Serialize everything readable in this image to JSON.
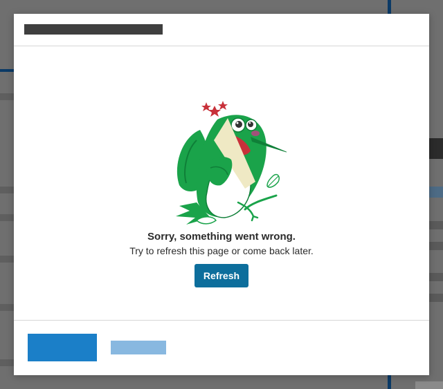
{
  "dialog": {
    "title": "",
    "error_title": "Sorry, something went wrong.",
    "error_message": "Try to refresh this page or come back later.",
    "refresh_label": "Refresh"
  },
  "footer": {
    "primary_label": "",
    "secondary_label": ""
  },
  "illustration": {
    "icon": "dizzy-hummingbird-illustration",
    "colors": {
      "green": "#1aa34a",
      "dark_green": "#0f7f38",
      "red": "#c8313a",
      "beak": "#efe9c4"
    }
  },
  "colors": {
    "refresh_button": "#0d6e9c",
    "primary_button": "#1b7fc8",
    "secondary_button": "#88b8e0",
    "text": "#2b2b2b"
  }
}
